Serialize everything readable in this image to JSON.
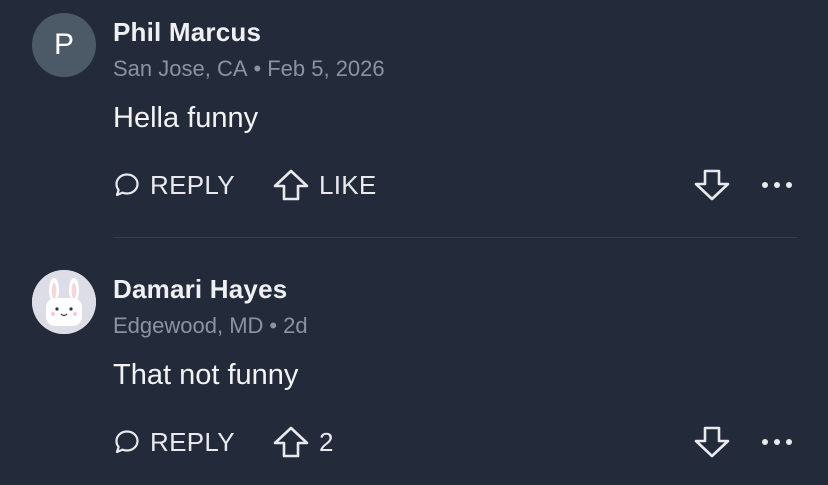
{
  "comments": [
    {
      "avatar_letter": "P",
      "author": "Phil Marcus",
      "location": "San Jose, CA",
      "separator": "•",
      "time": "Feb 5, 2026",
      "text": "Hella funny",
      "reply_label": "REPLY",
      "like_label": "LIKE"
    },
    {
      "avatar_icon": "bunny-avatar-icon",
      "author": "Damari Hayes",
      "location": "Edgewood, MD",
      "separator": "•",
      "time": "2d",
      "text": "That not funny",
      "reply_label": "REPLY",
      "like_count": "2"
    }
  ],
  "colors": {
    "background": "#232a3a",
    "primary_text": "#f2f3f5",
    "secondary_text": "#8b92a1",
    "avatar_letter_bg": "#4b5a66"
  }
}
